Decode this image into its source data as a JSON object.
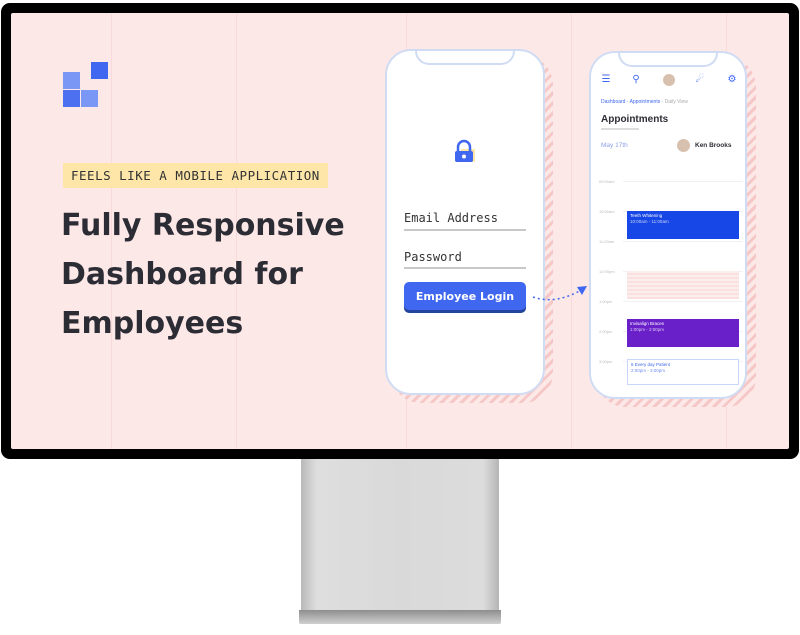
{
  "colors": {
    "screen_bg": "#fde8e8",
    "accent": "#3f67ef",
    "eyebrow_bg": "#fde6a8",
    "event_blue": "#1747e6",
    "event_purple": "#6a20c9"
  },
  "eyebrow": "FEELS LIKE A MOBILE APPLICATION",
  "headline": [
    "Fully Responsive",
    "Dashboard for",
    "Employees"
  ],
  "login_phone": {
    "email_label": "Email Address",
    "password_label": "Password",
    "login_button": "Employee Login",
    "icon": "lock-icon"
  },
  "dashboard_phone": {
    "top_icons": [
      "menu-icon",
      "search-icon",
      "avatar",
      "bell-icon",
      "settings-icon"
    ],
    "breadcrumb": [
      "Dashboard",
      "Appointments",
      "Daily View"
    ],
    "title": "Appointments",
    "date": "May 17th",
    "person": "Ken Brooks",
    "times": [
      "09:00am",
      "10:00am",
      "11:00am",
      "12:00pm",
      "1:00pm",
      "2:00pm",
      "3:00pm"
    ],
    "events": [
      {
        "title": "Teeth Whitening",
        "time": "10:00am - 11:00am"
      },
      {
        "title": "Invisalign Braces",
        "time": "1:00pm - 2:00pm"
      },
      {
        "title": "6 Every day Patient",
        "time": "2:00pm - 3:00pm"
      }
    ]
  }
}
